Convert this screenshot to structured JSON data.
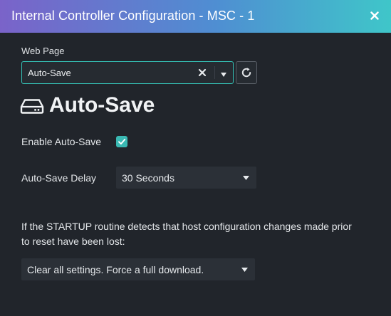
{
  "window": {
    "title": "Internal Controller Configuration - MSC - 1"
  },
  "web_page": {
    "label": "Web Page",
    "value": "Auto-Save"
  },
  "page": {
    "heading": "Auto-Save",
    "heading_icon": "drive-icon"
  },
  "enable_auto_save": {
    "label": "Enable Auto-Save",
    "checked": true
  },
  "delay": {
    "label": "Auto-Save Delay",
    "value": "30 Seconds"
  },
  "startup": {
    "description": "If the STARTUP routine detects that host configuration changes made prior to reset have been lost:",
    "value": "Clear all settings. Force a full download."
  },
  "colors": {
    "background": "#21252b",
    "accent": "#3ab9b3",
    "title_gradient_start": "#7a63c9",
    "title_gradient_end": "#3fc6c9"
  }
}
